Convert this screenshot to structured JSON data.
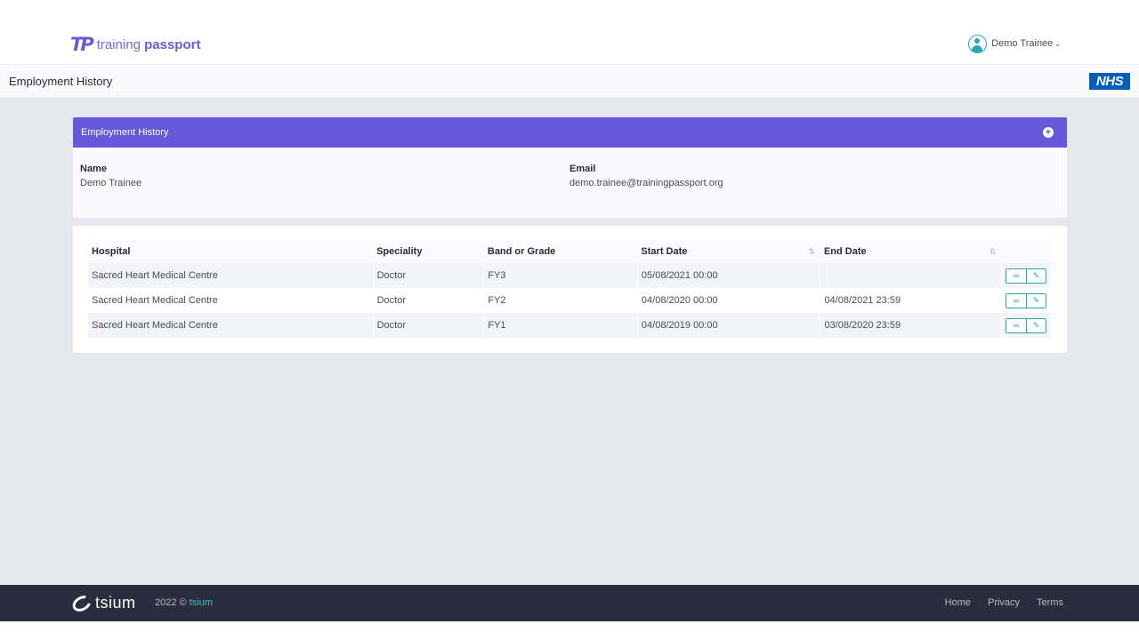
{
  "header": {
    "logo_mark": "TP",
    "logo_word1": "training",
    "logo_word2": "passport",
    "user_name": "Demo Trainee"
  },
  "subheader": {
    "title": "Employment History",
    "badge": "NHS"
  },
  "details_card": {
    "title": "Employment History",
    "add_icon": "plus-circle-icon",
    "name_label": "Name",
    "name_value": "Demo Trainee",
    "email_label": "Email",
    "email_value": "demo.trainee@trainingpassport.org"
  },
  "table": {
    "columns": [
      "Hospital",
      "Speciality",
      "Band or Grade",
      "Start Date",
      "End Date"
    ],
    "rows": [
      {
        "hospital": "Sacred Heart Medical Centre",
        "speciality": "Doctor",
        "grade": "FY3",
        "start": "05/08/2021 00:00",
        "end": ""
      },
      {
        "hospital": "Sacred Heart Medical Centre",
        "speciality": "Doctor",
        "grade": "FY2",
        "start": "04/08/2020 00:00",
        "end": "04/08/2021 23:59"
      },
      {
        "hospital": "Sacred Heart Medical Centre",
        "speciality": "Doctor",
        "grade": "FY1",
        "start": "04/08/2019 00:00",
        "end": "03/08/2020 23:59"
      }
    ]
  },
  "footer": {
    "logo_text": "tsium",
    "copyright": "2022 ©",
    "brand": "tsium",
    "links": [
      "Home",
      "Privacy",
      "Terms"
    ]
  },
  "colors": {
    "primary": "#6657db",
    "accent": "#2aa6ae",
    "footer_bg": "#2b2d3f",
    "nhs_blue": "#005eb8"
  }
}
